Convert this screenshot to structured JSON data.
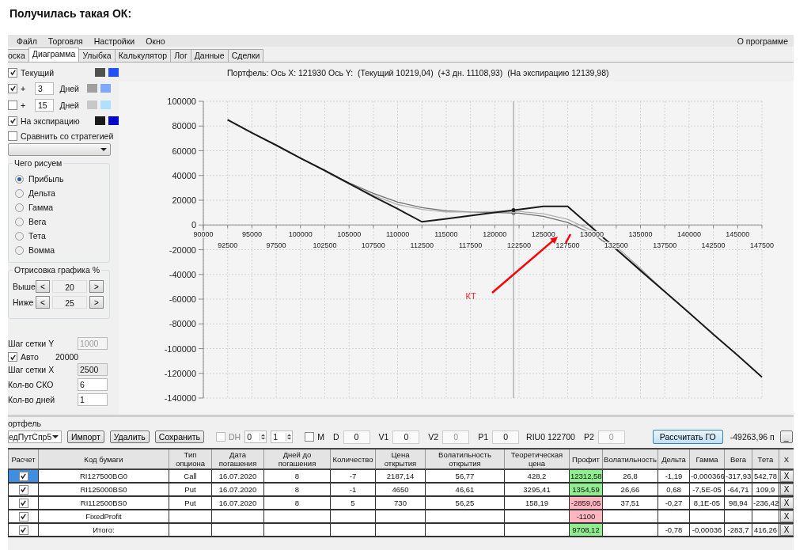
{
  "heading": "Получилась такая ОК:",
  "menu": [
    "Файл",
    "Торговля",
    "Настройки",
    "Окно"
  ],
  "menu_right": "О программе",
  "tabs": [
    {
      "label": "оска",
      "selected": false
    },
    {
      "label": "Диаграмма",
      "selected": true
    },
    {
      "label": "Улыбка",
      "selected": false
    },
    {
      "label": "Калькулятор",
      "selected": false
    },
    {
      "label": "Лог",
      "selected": false
    },
    {
      "label": "Данные",
      "selected": false
    },
    {
      "label": "Сделки",
      "selected": false
    }
  ],
  "curves": [
    {
      "kind": "plain",
      "label": "Текущий",
      "checked": true,
      "swatches": [
        {
          "color": "#505050"
        },
        {
          "color": "#2050ff"
        }
      ]
    },
    {
      "kind": "days",
      "plus": "+",
      "days": "3",
      "unit": "Дней",
      "checked": true,
      "swatches": [
        {
          "color": "#a0a0a0"
        },
        {
          "color": "#80a8ff"
        }
      ]
    },
    {
      "kind": "days",
      "plus": "+",
      "days": "15",
      "unit": "Дней",
      "checked": false,
      "swatches": [
        {
          "color": "#c8c8c8"
        },
        {
          "color": "#b0e0ff"
        }
      ]
    },
    {
      "kind": "plain",
      "label": "На экспирацию",
      "checked": true,
      "swatches": [
        {
          "color": "#1a1a1a"
        },
        {
          "color": "#0000cc"
        }
      ]
    }
  ],
  "compare": {
    "label": "Сравнить со стратегией",
    "checked": false
  },
  "draw_what": {
    "title": "Чего рисуем",
    "options": [
      {
        "label": "Прибыль",
        "selected": true
      },
      {
        "label": "Дельта",
        "selected": false
      },
      {
        "label": "Гамма",
        "selected": false
      },
      {
        "label": "Вега",
        "selected": false
      },
      {
        "label": "Тета",
        "selected": false
      },
      {
        "label": "Вомма",
        "selected": false
      }
    ]
  },
  "range": {
    "title": "Отрисовка графика %",
    "rows": [
      {
        "label": "Выше",
        "dec": "<",
        "value": "20",
        "inc": ">"
      },
      {
        "label": "Ниже",
        "dec": "<",
        "value": "25",
        "inc": ">"
      }
    ]
  },
  "grid": [
    {
      "kind": "field",
      "label": "Шаг сетки Y",
      "value": "1000",
      "disabled": true,
      "readonly": false
    },
    {
      "kind": "check",
      "label": "Авто",
      "checked": true,
      "value": "20000"
    },
    {
      "kind": "field",
      "label": "Шаг сетки X",
      "value": "2500",
      "disabled": false,
      "readonly": true
    },
    {
      "kind": "field",
      "label": "Кол-во СКО",
      "value": "6",
      "disabled": false,
      "readonly": false
    },
    {
      "kind": "field",
      "label": "Кол-во дней",
      "value": "1",
      "disabled": false,
      "readonly": false
    }
  ],
  "chart": {
    "lower_x_labels": [
      "92500",
      "97500",
      "102500",
      "107500",
      "112500",
      "117500",
      "122500",
      "127500",
      "132500",
      "137500",
      "142500",
      "147500"
    ],
    "title": "Портфель: Ось X: 121930 Ось Y:  (Текущий 10219,04)  (+3 дн. 11108,93)  (На экспирацию 12139,98)",
    "chart_data": {
      "type": "line",
      "x": [
        92500,
        95000,
        97500,
        100000,
        102500,
        105000,
        107500,
        110000,
        112500,
        115000,
        117500,
        120000,
        122500,
        125000,
        127500,
        130000,
        132500,
        135000,
        137500,
        140000,
        142500,
        145000,
        147500
      ],
      "series": [
        {
          "color": "#707070",
          "values": [
            85000,
            74500,
            64500,
            54000,
            44000,
            34000,
            25500,
            18500,
            14000,
            11500,
            10500,
            10000,
            9500,
            7000,
            2000,
            -7000,
            -20000,
            -36000,
            -54000,
            null,
            null,
            null,
            null
          ]
        },
        {
          "color": "#b0b0b0",
          "values": [
            null,
            null,
            null,
            null,
            43500,
            33000,
            24000,
            16500,
            12500,
            10500,
            10500,
            11000,
            11000,
            9000,
            4500,
            -4500,
            -17500,
            -35000,
            -54000,
            null,
            null,
            null,
            null
          ]
        },
        {
          "color": "#1a1a1a",
          "values": [
            85000,
            74500,
            64500,
            54000,
            44000,
            33500,
            23000,
            13000,
            2500,
            5000,
            7500,
            10000,
            12500,
            15000,
            15000,
            -2000,
            -19500,
            -37000,
            -54000,
            -71000,
            -88500,
            -105500,
            -123000
          ]
        }
      ],
      "xlim": [
        90000,
        147500
      ],
      "ylim": [
        -140000,
        100000
      ],
      "xticks": [
        90000,
        95000,
        100000,
        105000,
        110000,
        115000,
        120000,
        125000,
        130000,
        135000,
        140000,
        145000
      ],
      "yticks": [
        -140000,
        -120000,
        -100000,
        -80000,
        -60000,
        -40000,
        -20000,
        0,
        20000,
        40000,
        60000,
        80000,
        100000
      ],
      "grid": true,
      "ref_lines": [
        {
          "axis": "x",
          "value": 121930
        }
      ],
      "annotations": [
        "КТ"
      ]
    }
  },
  "portfolio": {
    "label": "ортфель",
    "toolbar": [
      {
        "kind": "dropdown",
        "value": "едПутСпр5"
      },
      {
        "kind": "button",
        "label": "Импорт"
      },
      {
        "kind": "button",
        "label": "Удалить"
      },
      {
        "kind": "button",
        "label": "Сохранить"
      },
      {
        "kind": "check",
        "label": "DH",
        "checked": false,
        "disabled": true
      },
      {
        "kind": "spinner",
        "value": "0"
      },
      {
        "kind": "spinner",
        "value": "1"
      },
      {
        "kind": "check",
        "label": "M",
        "checked": false,
        "disabled": false
      },
      {
        "kind": "field",
        "label": "D",
        "value": "0",
        "disabled": false
      },
      {
        "kind": "field",
        "label": "V1",
        "value": "0",
        "disabled": false
      },
      {
        "kind": "field",
        "label": "V2",
        "value": "0",
        "disabled": true
      },
      {
        "kind": "field",
        "label": "P1",
        "value": "0",
        "disabled": false
      },
      {
        "kind": "text",
        "text": "RIU0 122700"
      },
      {
        "kind": "field",
        "label": "P2",
        "value": "0",
        "disabled": true
      },
      {
        "kind": "primary-button",
        "label": "Рассчитать ГО"
      },
      {
        "kind": "text",
        "text": "-49263,96 п"
      },
      {
        "kind": "button",
        "label": "_"
      }
    ],
    "check_header": "Расчет",
    "columns": [
      "Код бумаги",
      "Тип опциона",
      "Дата погашения",
      "Дней до погашения",
      "Количество",
      "Цена открытия",
      "Волатильность открытия",
      "Теоретическая цена",
      "Профит",
      "Волатильность",
      "Дельта",
      "Гамма",
      "Вега",
      "Тета"
    ],
    "remove_header": "X",
    "rows": [
      {
        "checked": true,
        "selected": true,
        "color": "#90ee90",
        "remove": "X",
        "cells": [
          "RI127500BG0",
          "Call",
          "16.07.2020",
          "8",
          "-7",
          "2187,14",
          "56,77",
          "428,2",
          "12312,58",
          "26,8",
          "-1,19",
          "-0,000366",
          "-317,93",
          "542,78"
        ]
      },
      {
        "checked": true,
        "selected": false,
        "color": "#90ee90",
        "remove": "X",
        "cells": [
          "RI125000BS0",
          "Put",
          "16.07.2020",
          "8",
          "-1",
          "4650",
          "46,61",
          "3295,41",
          "1354,59",
          "26,66",
          "0,68",
          "-7,5E-05",
          "-64,71",
          "109,9"
        ]
      },
      {
        "checked": true,
        "selected": false,
        "color": "#ffb6c1",
        "remove": "X",
        "cells": [
          "RI112500BS0",
          "Put",
          "16.07.2020",
          "8",
          "5",
          "730",
          "56,25",
          "158,19",
          "-2859,05",
          "37,51",
          "-0,27",
          "8,1E-05",
          "98,94",
          "-236,42"
        ]
      },
      {
        "checked": true,
        "selected": false,
        "color": "#ffb6c1",
        "remove": "X",
        "cells": [
          "FixedProfit",
          null,
          null,
          null,
          null,
          null,
          null,
          null,
          "-1100",
          null,
          null,
          null,
          null,
          null
        ]
      },
      {
        "checked": true,
        "selected": false,
        "color": "#90ee90",
        "remove": "X",
        "cells": [
          "Итого:",
          null,
          null,
          null,
          null,
          null,
          null,
          null,
          "9708,12",
          null,
          "-0,78",
          "-0,00036",
          "-283,7",
          "416,26"
        ]
      }
    ]
  }
}
